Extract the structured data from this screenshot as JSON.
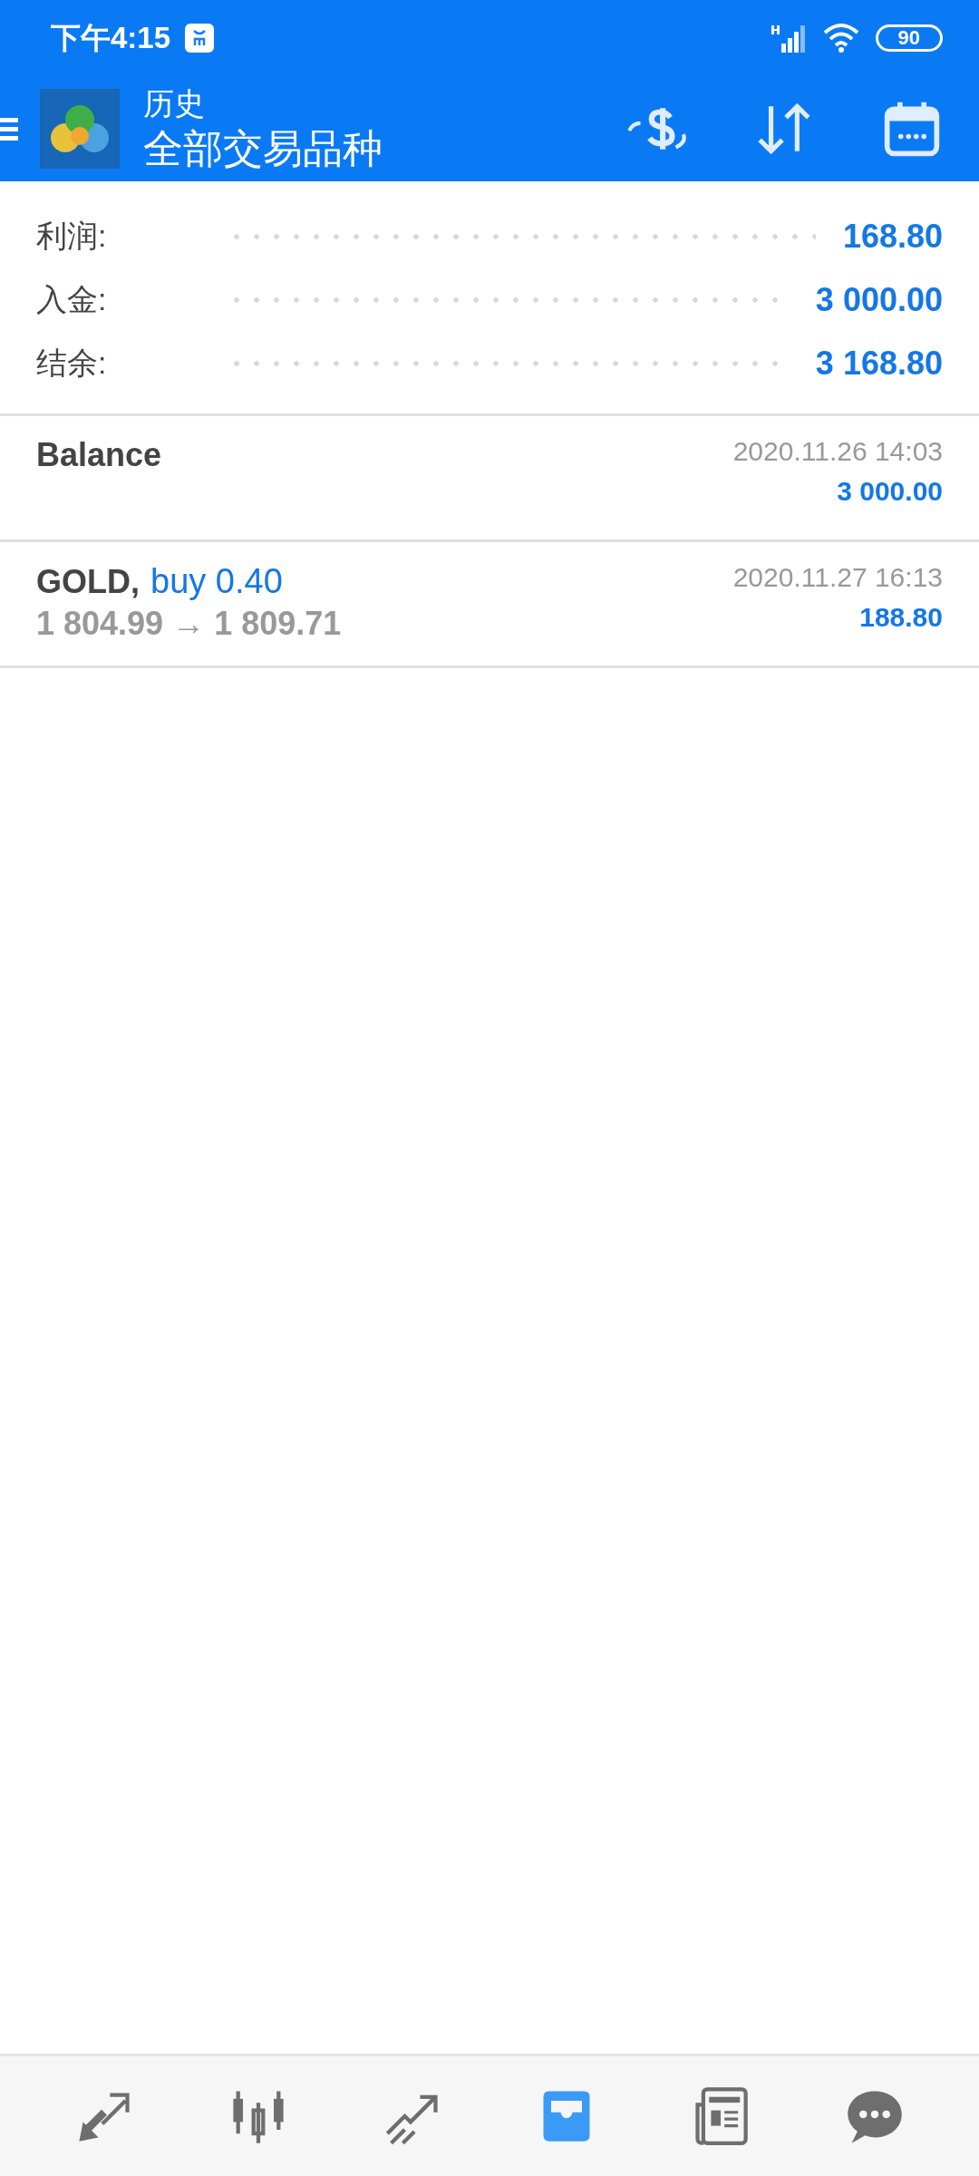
{
  "status_bar": {
    "time": "下午4:15",
    "battery": "90"
  },
  "header": {
    "title": "历史",
    "subtitle": "全部交易品种"
  },
  "summary": [
    {
      "label": "利润:",
      "value": "168.80"
    },
    {
      "label": "入金:",
      "value": "3 000.00"
    },
    {
      "label": "结余:",
      "value": "3 168.80"
    }
  ],
  "deals": [
    {
      "kind": "balance",
      "title": "Balance",
      "time": "2020.11.26 14:03",
      "amount": "3 000.00"
    },
    {
      "kind": "trade",
      "symbol": "GOLD,",
      "side": "buy 0.40",
      "prices": "1 804.99 → 1 809.71",
      "time": "2020.11.27 16:13",
      "amount": "188.80"
    }
  ],
  "nav": [
    {
      "kind": "trade",
      "selected": false
    },
    {
      "kind": "quotes",
      "selected": false
    },
    {
      "kind": "chart",
      "selected": false
    },
    {
      "kind": "history",
      "selected": true
    },
    {
      "kind": "news",
      "selected": false
    },
    {
      "kind": "chat",
      "selected": false
    }
  ]
}
